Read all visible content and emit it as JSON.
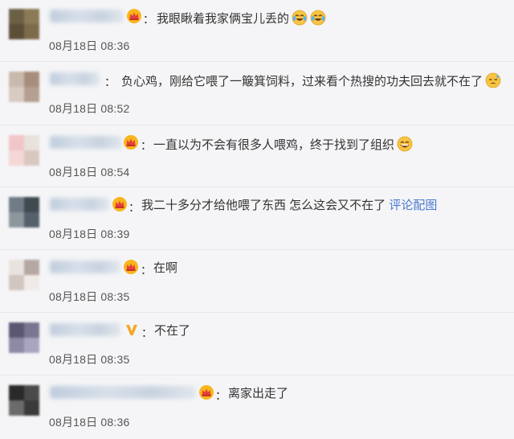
{
  "comments": [
    {
      "colon": "：",
      "text": "我眼瞅着我家俩宝儿丢的",
      "emojis": [
        "cry-laugh-icon",
        "cry-laugh-icon"
      ],
      "time": "08月18日 08:36",
      "badge": "crown-badge",
      "avatar_colors": [
        "#6b6046",
        "#8a7a56",
        "#5b4f38",
        "#7d6c4b"
      ]
    },
    {
      "colon": "：",
      "text": "负心鸡，刚给它喂了一簸箕饲料，过来看个热搜的功夫回去就不在了",
      "emojis": [
        "sweat-icon"
      ],
      "time": "08月18日 08:52",
      "badge": "",
      "avatar_colors": [
        "#c9b9ad",
        "#a88d7c",
        "#d8cbc2",
        "#b59f90"
      ]
    },
    {
      "colon": "：",
      "text": "一直以为不会有很多人喂鸡，终于找到了组织",
      "emojis": [
        "laugh-icon"
      ],
      "time": "08月18日 08:54",
      "badge": "crown-badge",
      "avatar_colors": [
        "#f0c6c9",
        "#e8e2dc",
        "#f4d7d6",
        "#d9c8bf"
      ]
    },
    {
      "colon": "：",
      "text": "我二十多分才给他喂了东西 怎么这会又不在了 ",
      "link": "评论配图",
      "emojis": [],
      "time": "08月18日 08:39",
      "badge": "crown-badge",
      "avatar_colors": [
        "#6f7c86",
        "#3f4a50",
        "#8c979d",
        "#55616a"
      ]
    },
    {
      "colon": "：",
      "text": "在啊",
      "emojis": [],
      "time": "08月18日 08:35",
      "badge": "crown-badge",
      "avatar_colors": [
        "#e9e3df",
        "#b5a7a1",
        "#d2c6c1",
        "#efeae7"
      ]
    },
    {
      "colon": "：",
      "text": "不在了",
      "emojis": [],
      "time": "08月18日 08:35",
      "badge": "verified-v-badge",
      "avatar_colors": [
        "#5b5672",
        "#7a7590",
        "#8d8aa6",
        "#a9a5bf"
      ]
    },
    {
      "colon": "：",
      "text": "离家出走了",
      "emojis": [],
      "time": "08月18日 08:36",
      "badge": "crown-badge",
      "avatar_colors": [
        "#2a2a2a",
        "#4a4a4a",
        "#6b6b6b",
        "#3a3a3a"
      ]
    }
  ],
  "colors": {
    "background": "#f5f5f7",
    "text": "#333333",
    "link": "#4a7bd1",
    "time": "#555555",
    "divider": "#e6e6e9"
  }
}
